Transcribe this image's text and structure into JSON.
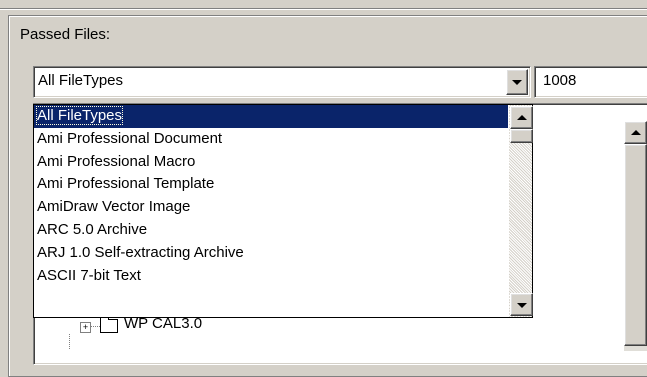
{
  "group": {
    "label": "Passed Files:"
  },
  "filetype_combo": {
    "value": "All FileTypes"
  },
  "count_box": {
    "value": "1008"
  },
  "dropdown": {
    "items": [
      "All FileTypes",
      "Ami Professional Document",
      "Ami Professional Macro",
      "Ami Professional Template",
      "AmiDraw Vector Image",
      "ARC 5.0 Archive",
      "ARJ 1.0 Self-extracting Archive",
      "ASCII 7-bit Text"
    ],
    "selected_index": 0
  },
  "tree": {
    "visible_node": "WP CAL3.0"
  },
  "colors": {
    "selection": "#0a246a",
    "face": "#d4d0c8"
  }
}
